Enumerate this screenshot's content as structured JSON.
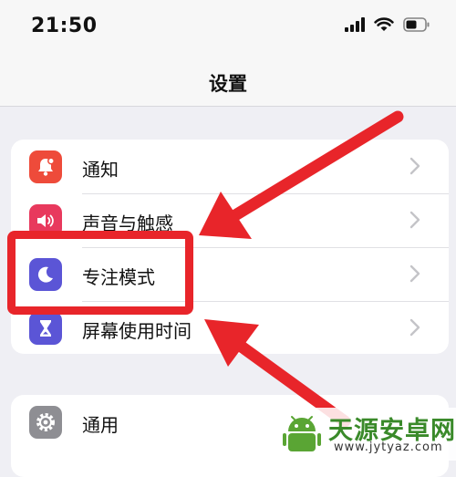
{
  "status_bar": {
    "time": "21:50",
    "icons": [
      "cellular-signal-icon",
      "wifi-icon",
      "battery-icon"
    ]
  },
  "nav": {
    "title": "设置"
  },
  "groups": [
    {
      "rows": [
        {
          "label": "通知",
          "icon": "bell-icon",
          "icon_color": "#ee4b3a"
        },
        {
          "label": "声音与触感",
          "icon": "speaker-icon",
          "icon_color": "#e8395d"
        },
        {
          "label": "专注模式",
          "icon": "moon-icon",
          "icon_color": "#5b55d6"
        },
        {
          "label": "屏幕使用时间",
          "icon": "hourglass-icon",
          "icon_color": "#5b55d6"
        }
      ]
    },
    {
      "rows": [
        {
          "label": "通用",
          "icon": "gear-icon",
          "icon_color": "#8e8e93"
        }
      ]
    }
  ],
  "annotation": {
    "highlight_color": "#e8252a",
    "highlighted_item": "专注模式"
  },
  "watermark": {
    "title": "天源安卓网",
    "url": "www.jytyaz.com"
  }
}
